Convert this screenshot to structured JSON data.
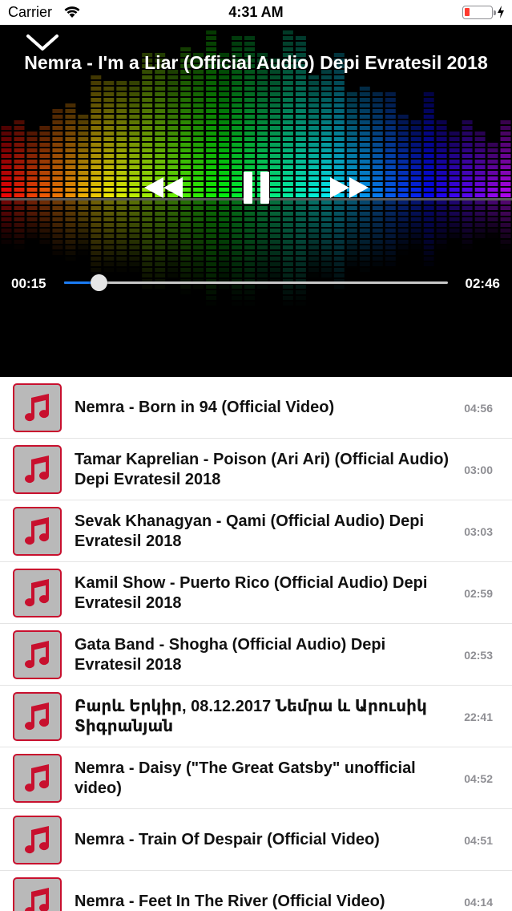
{
  "status_bar": {
    "carrier": "Carrier",
    "time": "4:31 AM",
    "battery_color": "#ff3b30"
  },
  "player": {
    "collapse_icon": "chevron-down-icon",
    "title": "Nemra - I'm a Liar (Official Audio) Depi Evratesil 2018",
    "controls": {
      "previous_icon": "rewind-icon",
      "pause_icon": "pause-icon",
      "next_icon": "fast-forward-icon"
    },
    "elapsed": "00:15",
    "total": "02:46",
    "progress_fraction": 0.09,
    "accent_color": "#1a7cf5",
    "background_art": "rainbow-equalizer-bars"
  },
  "playlist": {
    "thumbnail_icon": "music-note-icon",
    "thumbnail_border_color": "#c8102e",
    "items": [
      {
        "title": "Nemra - Born in 94 (Official Video)",
        "duration": "04:56"
      },
      {
        "title": "Tamar Kaprelian - Poison (Ari Ari) (Official Audio) Depi Evratesil 2018",
        "duration": "03:00"
      },
      {
        "title": "Sevak Khanagyan - Qami (Official Audio) Depi Evratesil 2018",
        "duration": "03:03"
      },
      {
        "title": "Kamil Show - Puerto Rico (Official Audio) Depi Evratesil 2018",
        "duration": "02:59"
      },
      {
        "title": "Gata Band - Shogha (Official Audio) Depi Evratesil 2018",
        "duration": "02:53"
      },
      {
        "title": "Բարև Երկիր, 08.12.2017 Նեմրա և Արուսիկ Տիգրանյան",
        "duration": "22:41"
      },
      {
        "title": "Nemra - Daisy (\"The Great Gatsby\" unofficial video)",
        "duration": "04:52"
      },
      {
        "title": "Nemra - Train Of Despair (Official Video)",
        "duration": "04:51"
      },
      {
        "title": "Nemra - Feet In The River (Official Video)",
        "duration": "04:14"
      }
    ]
  }
}
